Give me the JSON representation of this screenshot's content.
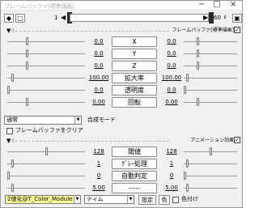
{
  "window": {
    "title": "フレームバッファ[標準描画]",
    "minimize": "−",
    "maximize": "□",
    "close": "×"
  },
  "timeline": {
    "frame_start": "1",
    "frame_end": "60",
    "progress": 0.0
  },
  "section1": {
    "label": "フレームバッファ[標準描画]",
    "enabled": true,
    "params": [
      {
        "value": "0.0",
        "label": "X",
        "pos_left": 0.25,
        "pos_right": 0.25
      },
      {
        "value": "0.0",
        "label": "Y",
        "pos_left": 0.25,
        "pos_right": 0.25
      },
      {
        "value": "0.0",
        "label": "Z",
        "pos_left": 0.25,
        "pos_right": 0.25
      },
      {
        "value": "100.00",
        "label": "拡大率",
        "pos_left": 0.05,
        "pos_right": 0.05
      },
      {
        "value": "0.0",
        "label": "透明度",
        "pos_left": 0.0,
        "pos_right": 0.0
      },
      {
        "value": "0.00",
        "label": "回転",
        "pos_left": 0.25,
        "pos_right": 0.25
      }
    ],
    "blend_mode": "通常",
    "blend_mode_label": "合成モード",
    "clear_buffer_label": "フレームバッファをクリア",
    "clear_buffer_checked": false
  },
  "section2": {
    "label": "アニメーション効果",
    "enabled": true,
    "params": [
      {
        "value": "128",
        "label": "閾値",
        "pos_left": 0.5,
        "pos_right": 0.5
      },
      {
        "value": "1",
        "label": "ｸﾞﾚｰ処理",
        "pos_left": 0.05,
        "pos_right": 0.05
      },
      {
        "value": "0",
        "label": "自動判定",
        "pos_left": 0.0,
        "pos_right": 0.0
      },
      {
        "value": "5.00",
        "label": "-----",
        "pos_left": 0.05,
        "pos_right": 0.05
      }
    ],
    "effect_select": "2値化@T_Color_Module",
    "timing_select": "ティム",
    "settings_button": "設定",
    "color_button": "色",
    "color_check_label": "色付け",
    "color_checked": false
  },
  "colors": {
    "accent": "#2f84d9",
    "highlight": "#ffff99"
  }
}
